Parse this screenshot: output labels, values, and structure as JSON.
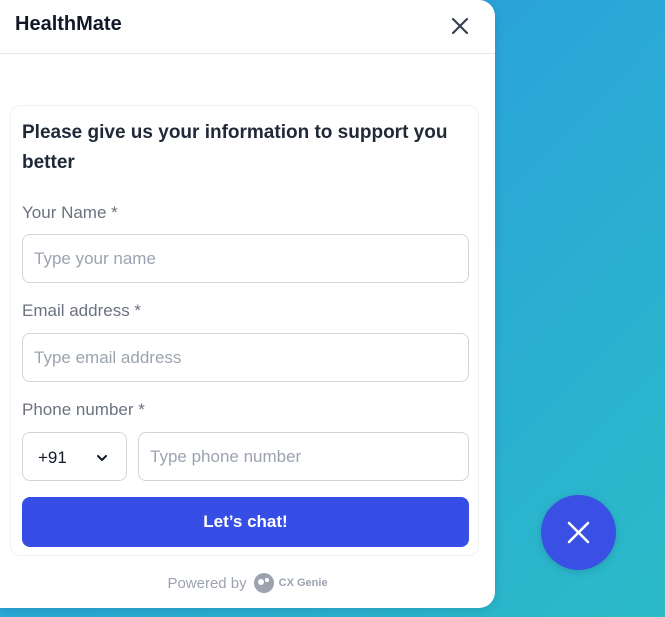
{
  "header": {
    "title": "HealthMate"
  },
  "form": {
    "heading": "Please give us your information to support you better",
    "name_label": "Your Name *",
    "name_placeholder": "Type your name",
    "email_label": "Email address *",
    "email_placeholder": "Type email address",
    "phone_label": "Phone number *",
    "country_code": "+91",
    "phone_placeholder": "Type phone number",
    "submit_label": "Let’s chat!"
  },
  "footer": {
    "powered_by": "Powered by",
    "brand": "CX Genie"
  },
  "icons": {
    "close": "close-icon",
    "chevron": "chevron-down-icon",
    "logo": "cx-genie-logo-icon",
    "launcher": "close-icon"
  },
  "colors": {
    "accent": "#374ee6",
    "launcher": "#3a4fe3",
    "background_start": "#2a8fd6",
    "background_end": "#2bbbc8"
  }
}
